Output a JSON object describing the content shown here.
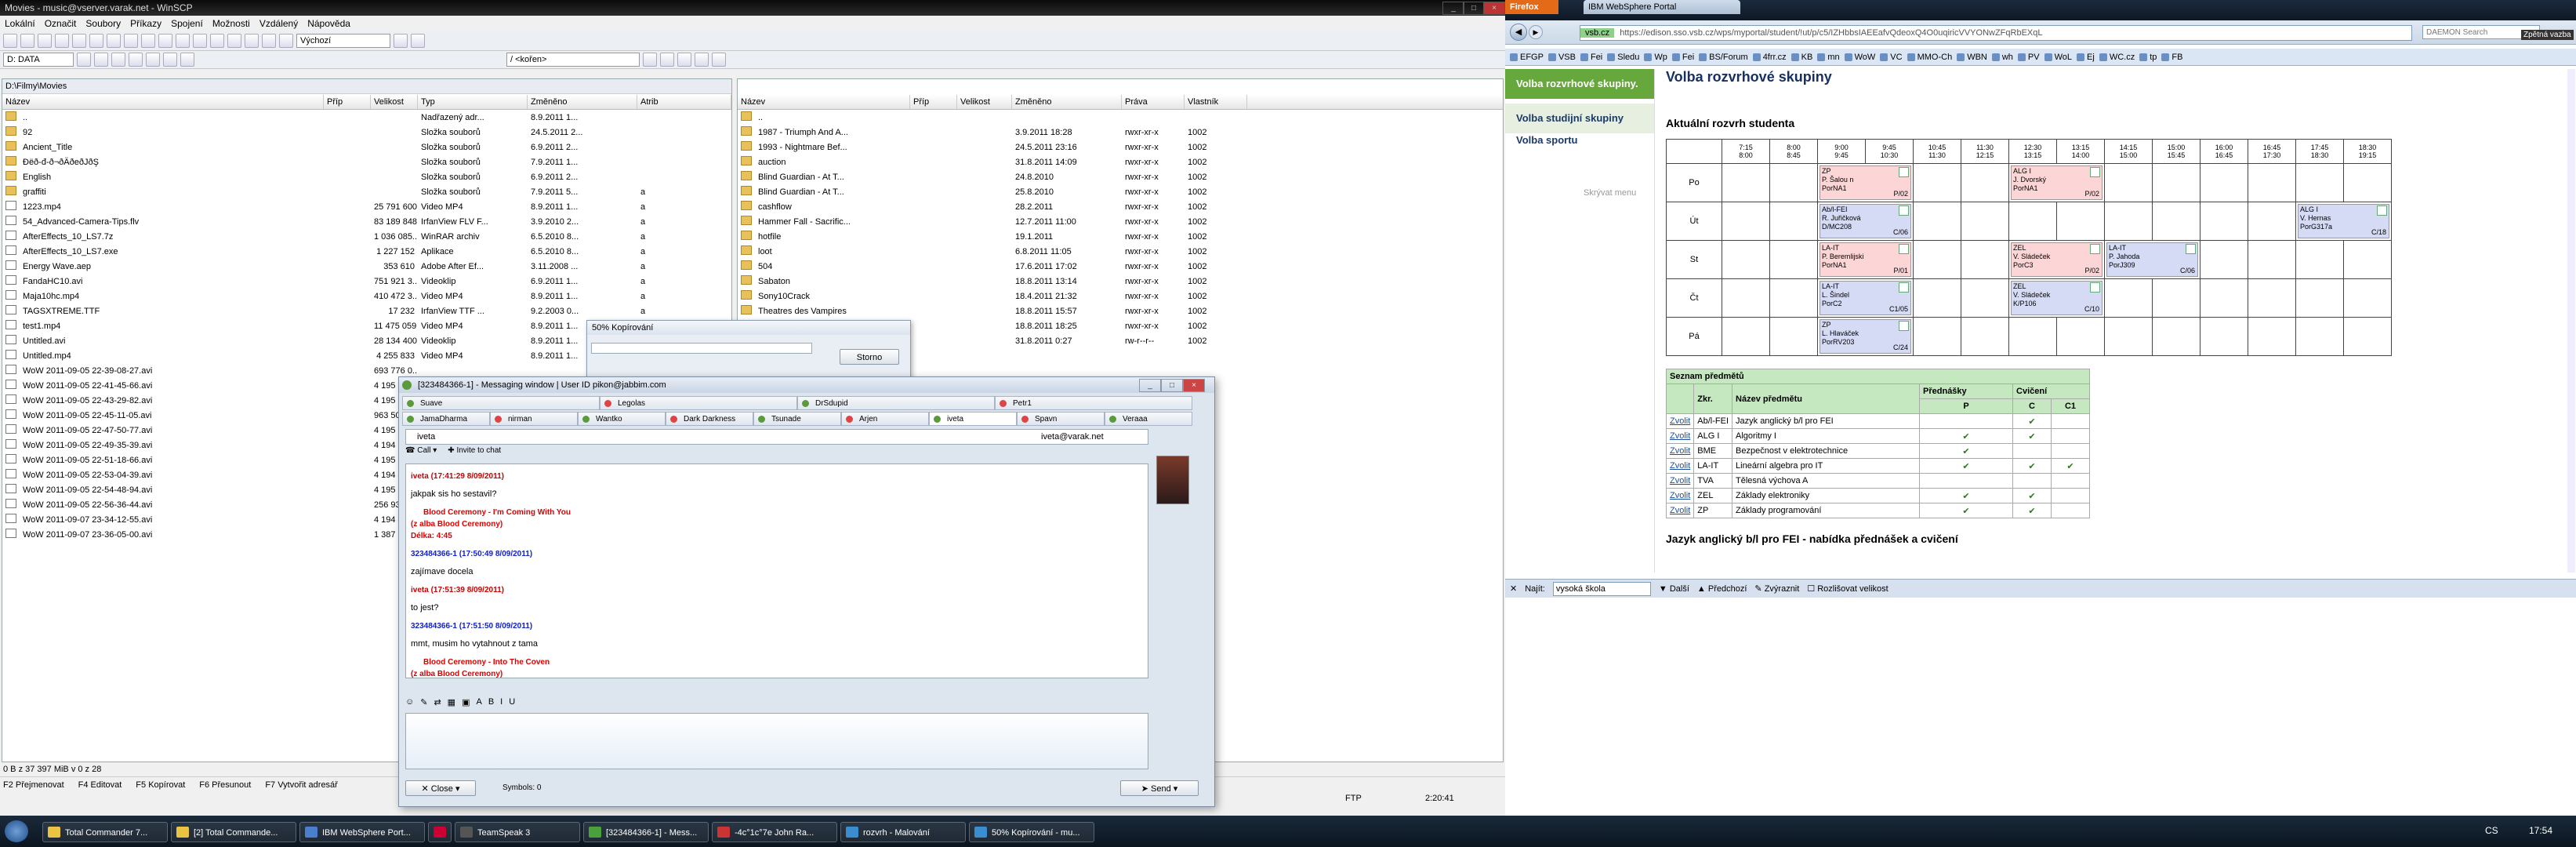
{
  "winscp": {
    "title": "Movies - music@vserver.varak.net - WinSCP",
    "menu": [
      "Lokální",
      "Označit",
      "Soubory",
      "Příkazy",
      "Spojení",
      "Možnosti",
      "Vzdálený",
      "Nápověda"
    ],
    "session_select": "Výchozí",
    "left_drive": "D: DATA",
    "left_path": "D:\\Filmy\\Movies",
    "left_columns": [
      "Název",
      "Příp",
      "Velikost",
      "Typ",
      "Změněno",
      "Atrib"
    ],
    "left_rows": [
      {
        "name": "..",
        "ext": "",
        "size": "",
        "type": "Nadřazený adr...",
        "date": "8.9.2011 1...",
        "attr": "",
        "kind": "folder"
      },
      {
        "name": "92",
        "ext": "",
        "size": "",
        "type": "Složka souborů",
        "date": "24.5.2011 2...",
        "attr": "",
        "kind": "folder"
      },
      {
        "name": "Ancient_Title",
        "ext": "",
        "size": "",
        "type": "Složka souborů",
        "date": "6.9.2011 2...",
        "attr": "",
        "kind": "folder"
      },
      {
        "name": "Ðëð-đ-ð¬ðÄðeðJðŞ",
        "ext": "",
        "size": "",
        "type": "Složka souborů",
        "date": "7.9.2011 1...",
        "attr": "",
        "kind": "folder"
      },
      {
        "name": "English",
        "ext": "",
        "size": "",
        "type": "Složka souborů",
        "date": "6.9.2011 2...",
        "attr": "",
        "kind": "folder"
      },
      {
        "name": "graffiti",
        "ext": "",
        "size": "",
        "type": "Složka souborů",
        "date": "7.9.2011 5...",
        "attr": "a",
        "kind": "folder"
      },
      {
        "name": "1223.mp4",
        "ext": "",
        "size": "25 791 600",
        "type": "Video MP4",
        "date": "8.9.2011 1...",
        "attr": "a",
        "kind": "file"
      },
      {
        "name": "54_Advanced-Camera-Tips.flv",
        "ext": "",
        "size": "83 189 848",
        "type": "IrfanView FLV F...",
        "date": "3.9.2010 2...",
        "attr": "a",
        "kind": "file"
      },
      {
        "name": "AfterEffects_10_LS7.7z",
        "ext": "",
        "size": "1 036 085...",
        "type": "WinRAR archiv",
        "date": "6.5.2010 8...",
        "attr": "a",
        "kind": "file"
      },
      {
        "name": "AfterEffects_10_LS7.exe",
        "ext": "",
        "size": "1 227 152",
        "type": "Aplikace",
        "date": "6.5.2010 8...",
        "attr": "a",
        "kind": "file"
      },
      {
        "name": "Energy Wave.aep",
        "ext": "",
        "size": "353 610",
        "type": "Adobe After Ef...",
        "date": "3.11.2008 ...",
        "attr": "a",
        "kind": "file"
      },
      {
        "name": "FandaHC10.avi",
        "ext": "",
        "size": "751 921 3...",
        "type": "Videoklip",
        "date": "6.9.2011 1...",
        "attr": "a",
        "kind": "file"
      },
      {
        "name": "Maja10hc.mp4",
        "ext": "",
        "size": "410 472 3...",
        "type": "Video MP4",
        "date": "8.9.2011 1...",
        "attr": "a",
        "kind": "file"
      },
      {
        "name": "TAGSXTREME.TTF",
        "ext": "",
        "size": "17 232",
        "type": "IrfanView TTF ...",
        "date": "9.2.2003 0...",
        "attr": "a",
        "kind": "file"
      },
      {
        "name": "test1.mp4",
        "ext": "",
        "size": "11 475 059",
        "type": "Video MP4",
        "date": "8.9.2011 1...",
        "attr": "a",
        "kind": "file"
      },
      {
        "name": "Untitled.avi",
        "ext": "",
        "size": "28 134 400",
        "type": "Videoklip",
        "date": "8.9.2011 1...",
        "attr": "a",
        "kind": "file"
      },
      {
        "name": "Untitled.mp4",
        "ext": "",
        "size": "4 255 833",
        "type": "Video MP4",
        "date": "8.9.2011 1...",
        "attr": "a",
        "kind": "file"
      },
      {
        "name": "WoW 2011-09-05 22-39-08-27.avi",
        "ext": "",
        "size": "693 776 0...",
        "type": "",
        "date": "",
        "attr": "",
        "kind": "file"
      },
      {
        "name": "WoW 2011-09-05 22-41-45-66.avi",
        "ext": "",
        "size": "4 195 312...",
        "type": "",
        "date": "",
        "attr": "",
        "kind": "file"
      },
      {
        "name": "WoW 2011-09-05 22-43-29-82.avi",
        "ext": "",
        "size": "4 195 577...",
        "type": "",
        "date": "",
        "attr": "",
        "kind": "file"
      },
      {
        "name": "WoW 2011-09-05 22-45-11-05.avi",
        "ext": "",
        "size": "963 501 5...",
        "type": "",
        "date": "",
        "attr": "",
        "kind": "file"
      },
      {
        "name": "WoW 2011-09-05 22-47-50-77.avi",
        "ext": "",
        "size": "4 195 537...",
        "type": "",
        "date": "",
        "attr": "",
        "kind": "file"
      },
      {
        "name": "WoW 2011-09-05 22-49-35-39.avi",
        "ext": "",
        "size": "4 194 855...",
        "type": "",
        "date": "",
        "attr": "",
        "kind": "file"
      },
      {
        "name": "WoW 2011-09-05 22-51-18-66.avi",
        "ext": "",
        "size": "4 195 013...",
        "type": "",
        "date": "",
        "attr": "",
        "kind": "file"
      },
      {
        "name": "WoW 2011-09-05 22-53-04-39.avi",
        "ext": "",
        "size": "4 194 456...",
        "type": "",
        "date": "",
        "attr": "",
        "kind": "file"
      },
      {
        "name": "WoW 2011-09-05 22-54-48-94.avi",
        "ext": "",
        "size": "4 195 273...",
        "type": "",
        "date": "",
        "attr": "",
        "kind": "file"
      },
      {
        "name": "WoW 2011-09-05 22-56-36-44.avi",
        "ext": "",
        "size": "256 933 2...",
        "type": "",
        "date": "",
        "attr": "",
        "kind": "file"
      },
      {
        "name": "WoW 2011-09-07 23-34-12-55.avi",
        "ext": "",
        "size": "4 194 415...",
        "type": "",
        "date": "",
        "attr": "",
        "kind": "file"
      },
      {
        "name": "WoW 2011-09-07 23-36-05-00.avi",
        "ext": "",
        "size": "1 387 505...",
        "type": "",
        "date": "",
        "attr": "",
        "kind": "file"
      }
    ],
    "right_path": "/ <kořen>",
    "right_columns": [
      "Název",
      "Příp",
      "Velikost",
      "Změněno",
      "Práva",
      "Vlastník"
    ],
    "right_rows": [
      {
        "name": "..",
        "date": "",
        "rights": "",
        "owner": ""
      },
      {
        "name": "1987 - Triumph And A...",
        "date": "3.9.2011 18:28",
        "rights": "rwxr-xr-x",
        "owner": "1002"
      },
      {
        "name": "1993 - Nightmare Bef...",
        "date": "24.5.2011 23:16",
        "rights": "rwxr-xr-x",
        "owner": "1002"
      },
      {
        "name": "auction",
        "date": "31.8.2011 14:09",
        "rights": "rwxr-xr-x",
        "owner": "1002"
      },
      {
        "name": "Blind Guardian - At T...",
        "date": "24.8.2010",
        "rights": "rwxr-xr-x",
        "owner": "1002"
      },
      {
        "name": "Blind Guardian - At T...",
        "date": "25.8.2010",
        "rights": "rwxr-xr-x",
        "owner": "1002"
      },
      {
        "name": "cashflow",
        "date": "28.2.2011",
        "rights": "rwxr-xr-x",
        "owner": "1002"
      },
      {
        "name": "Hammer Fall - Sacrific...",
        "date": "12.7.2011 11:00",
        "rights": "rwxr-xr-x",
        "owner": "1002"
      },
      {
        "name": "hotfile",
        "date": "19.1.2011",
        "rights": "rwxr-xr-x",
        "owner": "1002"
      },
      {
        "name": "loot",
        "date": "6.8.2011 11:05",
        "rights": "rwxr-xr-x",
        "owner": "1002"
      },
      {
        "name": "504",
        "date": "17.6.2011 17:02",
        "rights": "rwxr-xr-x",
        "owner": "1002"
      },
      {
        "name": "Sabaton",
        "date": "18.8.2011 13:14",
        "rights": "rwxr-xr-x",
        "owner": "1002"
      },
      {
        "name": "Sony10Crack",
        "date": "18.4.2011 21:32",
        "rights": "rwxr-xr-x",
        "owner": "1002"
      },
      {
        "name": "Theatres des Vampires",
        "date": "18.8.2011 15:57",
        "rights": "rwxr-xr-x",
        "owner": "1002"
      },
      {
        "name": "Therion",
        "date": "18.8.2011 18:25",
        "rights": "rwxr-xr-x",
        "owner": "1002"
      },
      {
        "name": "",
        "date": "31.8.2011 0:27",
        "rights": "rw-r--r--",
        "owner": "1002"
      }
    ],
    "status_left": "0 B z 37 397 MiB v 0 z 28",
    "fkeys": [
      "F2 Přejmenovat",
      "F4 Editovat",
      "F5 Kopírovat",
      "F6 Přesunout",
      "F7 Vytvořit adresář"
    ],
    "status_right_proto": "FTP",
    "status_right_time": "2:20:41"
  },
  "copy_dialog": {
    "title": "50% Kopírování",
    "cancel": "Storno"
  },
  "messenger": {
    "title": "[323484366-1] - Messaging window | User ID pikon@jabbim.com",
    "tabs_row1": [
      "Suave",
      "Legolas",
      "DrSdupid",
      "Petr1"
    ],
    "tabs_row2": [
      "JamaDharma",
      "nirman",
      "Wantko",
      "Dark Darkness",
      "Tsunade",
      "Arjen",
      "iveta",
      "Spavn",
      "Veraaa"
    ],
    "contact": "iveta",
    "contact_jid": "iveta@varak.net",
    "call_label": "Call",
    "invite_label": "Invite to chat",
    "messages": [
      {
        "who": "iveta (17:41:29 8/09/2011)",
        "color": "r",
        "text": "jakpak sis ho sestavil?"
      },
      {
        "song": "Blood Ceremony - I'm Coming With You",
        "album": "(z alba Blood Ceremony)",
        "len": "Délka: 4:45"
      },
      {
        "who": "323484366-1 (17:50:49 8/09/2011)",
        "color": "b",
        "text": "zajímave docela"
      },
      {
        "who": "iveta (17:51:39 8/09/2011)",
        "color": "r",
        "text": "to jest?"
      },
      {
        "who": "323484366-1 (17:51:50 8/09/2011)",
        "color": "b",
        "text": "mmt, musim ho vytahnout z tama"
      },
      {
        "song": "Blood Ceremony - Into The Coven",
        "album": "(z alba Blood Ceremony)",
        "len": "Délka: 4:22"
      }
    ],
    "close_label": "Close",
    "symbols": "Symbols: 0",
    "send_label": "Send"
  },
  "firefox": {
    "tab_brand": "Firefox",
    "tab_title": "IBM WebSphere Portal",
    "url_host": "vsb.cz",
    "url": "https://edison.sso.vsb.cz/wps/myportal/student/!ut/p/c5/IZHbbsIAEEafvQdeoxQ4O0uqiricVVYONwZFqRbEXqL",
    "search_placeholder": "DAEMON Search",
    "zpetna": "Zpětná vazba",
    "bookmarks": [
      "EFGP",
      "VSB",
      "Fei",
      "Sledu",
      "Wp",
      "Fei",
      "BS/Forum",
      "4frr.cz",
      "KB",
      "mn",
      "WoW",
      "VC",
      "MMO-Ch",
      "WBN",
      "wh",
      "PV",
      "WoL",
      "Ej",
      "WC.cz",
      "tp",
      "FB"
    ],
    "nav": [
      "Volba rozvrhové skupiny.",
      "Volba studijní skupiny",
      "Volba sportu"
    ],
    "hide_menu": "Skrývat menu",
    "page_title": "Volba rozvrhové skupiny",
    "rozvrh_title": "Aktuální rozvrh studenta",
    "times": [
      [
        "7:15",
        "8:00"
      ],
      [
        "8:00",
        "8:45"
      ],
      [
        "9:00",
        "9:45"
      ],
      [
        "9:45",
        "10:30"
      ],
      [
        "10:45",
        "11:30"
      ],
      [
        "11:30",
        "12:15"
      ],
      [
        "12:30",
        "13:15"
      ],
      [
        "13:15",
        "14:00"
      ],
      [
        "14:15",
        "15:00"
      ],
      [
        "15:00",
        "15:45"
      ],
      [
        "16:00",
        "16:45"
      ],
      [
        "16:45",
        "17:30"
      ],
      [
        "17:45",
        "18:30"
      ],
      [
        "18:30",
        "19:15"
      ]
    ],
    "days": [
      "Po",
      "Út",
      "St",
      "Čt",
      "Pá"
    ],
    "lessons": [
      {
        "day": 0,
        "slot": 2,
        "span": 2,
        "c": "pink",
        "l1": "ZP",
        "l2": "P. Šalou n",
        "l3": "PorNA1",
        "code": "P/02"
      },
      {
        "day": 0,
        "slot": 6,
        "span": 2,
        "c": "pink",
        "l1": "ALG I",
        "l2": "J. Dvorský",
        "l3": "PorNA1",
        "code": "P/02"
      },
      {
        "day": 1,
        "slot": 2,
        "span": 2,
        "c": "blue",
        "l1": "Ab/l-FEI",
        "l2": "R. Juřičková",
        "l3": "D/MC208",
        "code": "C/06"
      },
      {
        "day": 1,
        "slot": 12,
        "span": 2,
        "c": "blue",
        "l1": "ALG I",
        "l2": "V. Hernas",
        "l3": "PorG317a",
        "code": "C/18"
      },
      {
        "day": 2,
        "slot": 2,
        "span": 2,
        "c": "pink",
        "l1": "LA-IT",
        "l2": "P. Beremlijski",
        "l3": "PorNA1",
        "code": "P/01"
      },
      {
        "day": 2,
        "slot": 6,
        "span": 2,
        "c": "pink",
        "l1": "ZEL",
        "l2": "V. Sládeček",
        "l3": "PorC3",
        "code": "P/02"
      },
      {
        "day": 2,
        "slot": 8,
        "span": 2,
        "c": "blue",
        "l1": "LA-IT",
        "l2": "P. Jahoda",
        "l3": "PorJ309",
        "code": "C/06"
      },
      {
        "day": 3,
        "slot": 2,
        "span": 2,
        "c": "blue",
        "l1": "LA-IT",
        "l2": "L. Šindel",
        "l3": "PorC2",
        "code": "C1/05"
      },
      {
        "day": 3,
        "slot": 6,
        "span": 2,
        "c": "blue",
        "l1": "ZEL",
        "l2": "V. Sládeček",
        "l3": "K/P106",
        "code": "C/10"
      },
      {
        "day": 4,
        "slot": 2,
        "span": 2,
        "c": "blue",
        "l1": "ZP",
        "l2": "L. Hlaváček",
        "l3": "PorRV203",
        "code": "C/24"
      }
    ],
    "subjects_title": "Seznam předmětů",
    "subj_head1": [
      "Zkr.",
      "Název předmětu",
      "Přednášky",
      "Cvičení"
    ],
    "subj_head2": [
      "P",
      "C",
      "C1"
    ],
    "subjects": [
      {
        "link": "Zvolit",
        "abbr": "Ab/l-FEI",
        "name": "Jazyk anglický b/l pro FEI",
        "p": "",
        "c": "✔",
        "c1": ""
      },
      {
        "link": "Zvolit",
        "abbr": "ALG I",
        "name": "Algoritmy I",
        "p": "✔",
        "c": "✔",
        "c1": ""
      },
      {
        "link": "Zvolit",
        "abbr": "BME",
        "name": "Bezpečnost v elektrotechnice",
        "p": "✔",
        "c": "",
        "c1": ""
      },
      {
        "link": "Zvolit",
        "abbr": "LA-IT",
        "name": "Lineární algebra pro IT",
        "p": "✔",
        "c": "✔",
        "c1": "✔"
      },
      {
        "link": "Zvolit",
        "abbr": "TVA",
        "name": "Tělesná výchova A",
        "p": "",
        "c": "",
        "c1": ""
      },
      {
        "link": "Zvolit",
        "abbr": "ZEL",
        "name": "Základy elektroniky",
        "p": "✔",
        "c": "✔",
        "c1": ""
      },
      {
        "link": "Zvolit",
        "abbr": "ZP",
        "name": "Základy programování",
        "p": "✔",
        "c": "✔",
        "c1": ""
      }
    ],
    "bottom_heading": "Jazyk anglický b/l pro FEI - nabídka přednášek a cvičení",
    "find_label": "Najít:",
    "find_value": "vysoká škola",
    "find_next": "Další",
    "find_prev": "Předchozí",
    "find_highlight": "Zvýraznit",
    "find_case": "Rozlišovat velikost"
  },
  "taskbar": {
    "buttons": [
      "Total Commander 7...",
      "[2] Total Commande...",
      "IBM WebSphere Port...",
      "",
      "TeamSpeak 3",
      "[323484366-1] - Mess...",
      "-4c°1c°7e John Ra...",
      "rozvrh - Malování",
      "50% Kopírování - mu..."
    ],
    "lang": "CS",
    "time": "17:54"
  }
}
